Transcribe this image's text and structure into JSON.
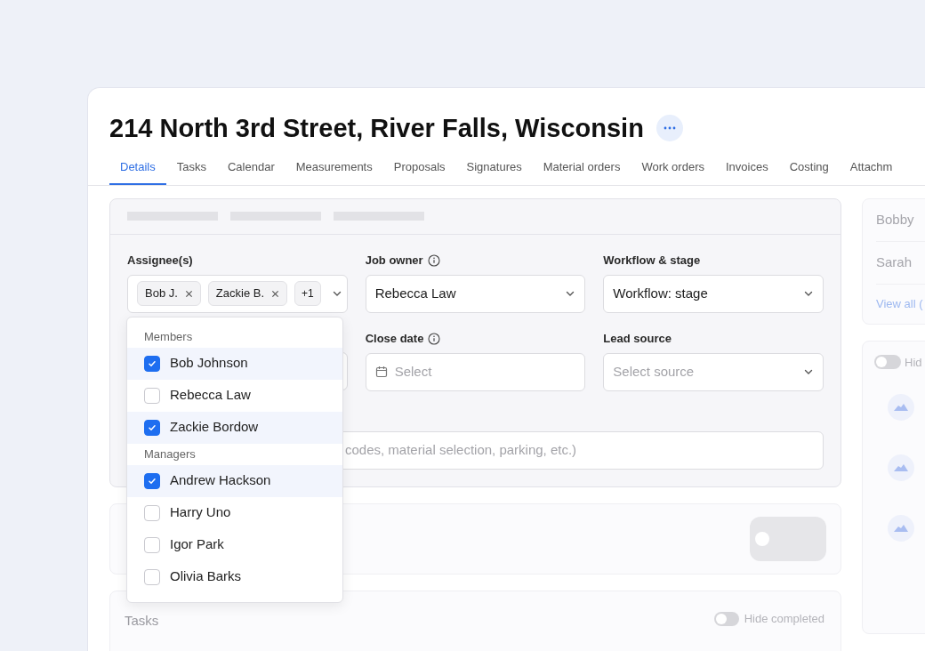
{
  "title": "214 North 3rd Street, River Falls, Wisconsin",
  "tabs": [
    {
      "label": "Details",
      "selected": true
    },
    {
      "label": "Tasks",
      "selected": false
    },
    {
      "label": "Calendar",
      "selected": false
    },
    {
      "label": "Measurements",
      "selected": false
    },
    {
      "label": "Proposals",
      "selected": false
    },
    {
      "label": "Signatures",
      "selected": false
    },
    {
      "label": "Material orders",
      "selected": false
    },
    {
      "label": "Work orders",
      "selected": false
    },
    {
      "label": "Invoices",
      "selected": false
    },
    {
      "label": "Costing",
      "selected": false
    },
    {
      "label": "Attachm",
      "selected": false
    }
  ],
  "fields": [
    {
      "kind": "tags",
      "label": "Assignee(s)",
      "info": false,
      "tags": [
        "Bob J.",
        "Zackie B."
      ],
      "more": "+1"
    },
    {
      "kind": "select",
      "label": "Job owner",
      "info": true,
      "value": "Rebecca Law"
    },
    {
      "kind": "select",
      "label": "Workflow & stage",
      "info": false,
      "value": "Workflow: stage"
    },
    {
      "kind": "covered"
    },
    {
      "kind": "date",
      "label": "Close date",
      "info": true,
      "placeholder": "Select"
    },
    {
      "kind": "select",
      "label": "Lead source",
      "info": false,
      "placeholder": "Select source"
    }
  ],
  "notes": {
    "placeholder": "codes, material selection, parking, etc.)"
  },
  "dropdown": [
    {
      "heading": "Members",
      "options": [
        {
          "label": "Bob Johnson",
          "checked": true
        },
        {
          "label": "Rebecca Law",
          "checked": false
        },
        {
          "label": "Zackie Bordow",
          "checked": true
        }
      ]
    },
    {
      "heading": "Managers",
      "options": [
        {
          "label": "Andrew Hackson",
          "checked": true
        },
        {
          "label": "Harry Uno",
          "checked": false
        },
        {
          "label": "Igor Park",
          "checked": false
        },
        {
          "label": "Olivia Barks",
          "checked": false
        }
      ]
    }
  ],
  "section_toggle": {
    "on": false
  },
  "tasks": {
    "title": "Tasks",
    "toggle_label": "Hide completed",
    "on": false
  },
  "side": {
    "people": [
      "Bobby",
      "Sarah"
    ],
    "link": "View all (",
    "toggle_label": "Hid",
    "on": false
  }
}
